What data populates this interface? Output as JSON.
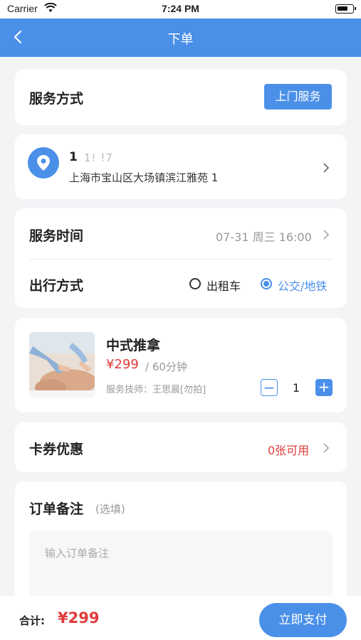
{
  "status_bar": {
    "carrier": "Carrier",
    "time": "7:24 PM"
  },
  "nav": {
    "title": "下单",
    "back_icon": "chevron-left-icon"
  },
  "service_mode": {
    "label": "服务方式",
    "button": "上门服务"
  },
  "address": {
    "name": "1",
    "phone": "1!             !7",
    "line": "上海市宝山区大场镇滨江雅苑 1"
  },
  "service_time": {
    "label": "服务时间",
    "value": "07-31 周三 16:00"
  },
  "travel": {
    "label": "出行方式",
    "options": [
      {
        "label": "出租车",
        "selected": false
      },
      {
        "label": "公交/地铁",
        "selected": true
      }
    ]
  },
  "product": {
    "name": "中式推拿",
    "price": "¥299",
    "duration": "/ 60分钟",
    "technician": "服务技师：王思晨[勿拍]",
    "quantity": "1",
    "minus": "−",
    "plus": "+"
  },
  "coupon": {
    "label": "卡券优惠",
    "value": "0张可用"
  },
  "remark": {
    "label": "订单备注",
    "optional": "(选填)",
    "placeholder": "输入订单备注"
  },
  "footer": {
    "total_label": "合计:",
    "total_value": "¥299",
    "pay_button": "立即支付"
  },
  "colors": {
    "primary": "#4a90e8",
    "price": "#e03b3b"
  }
}
